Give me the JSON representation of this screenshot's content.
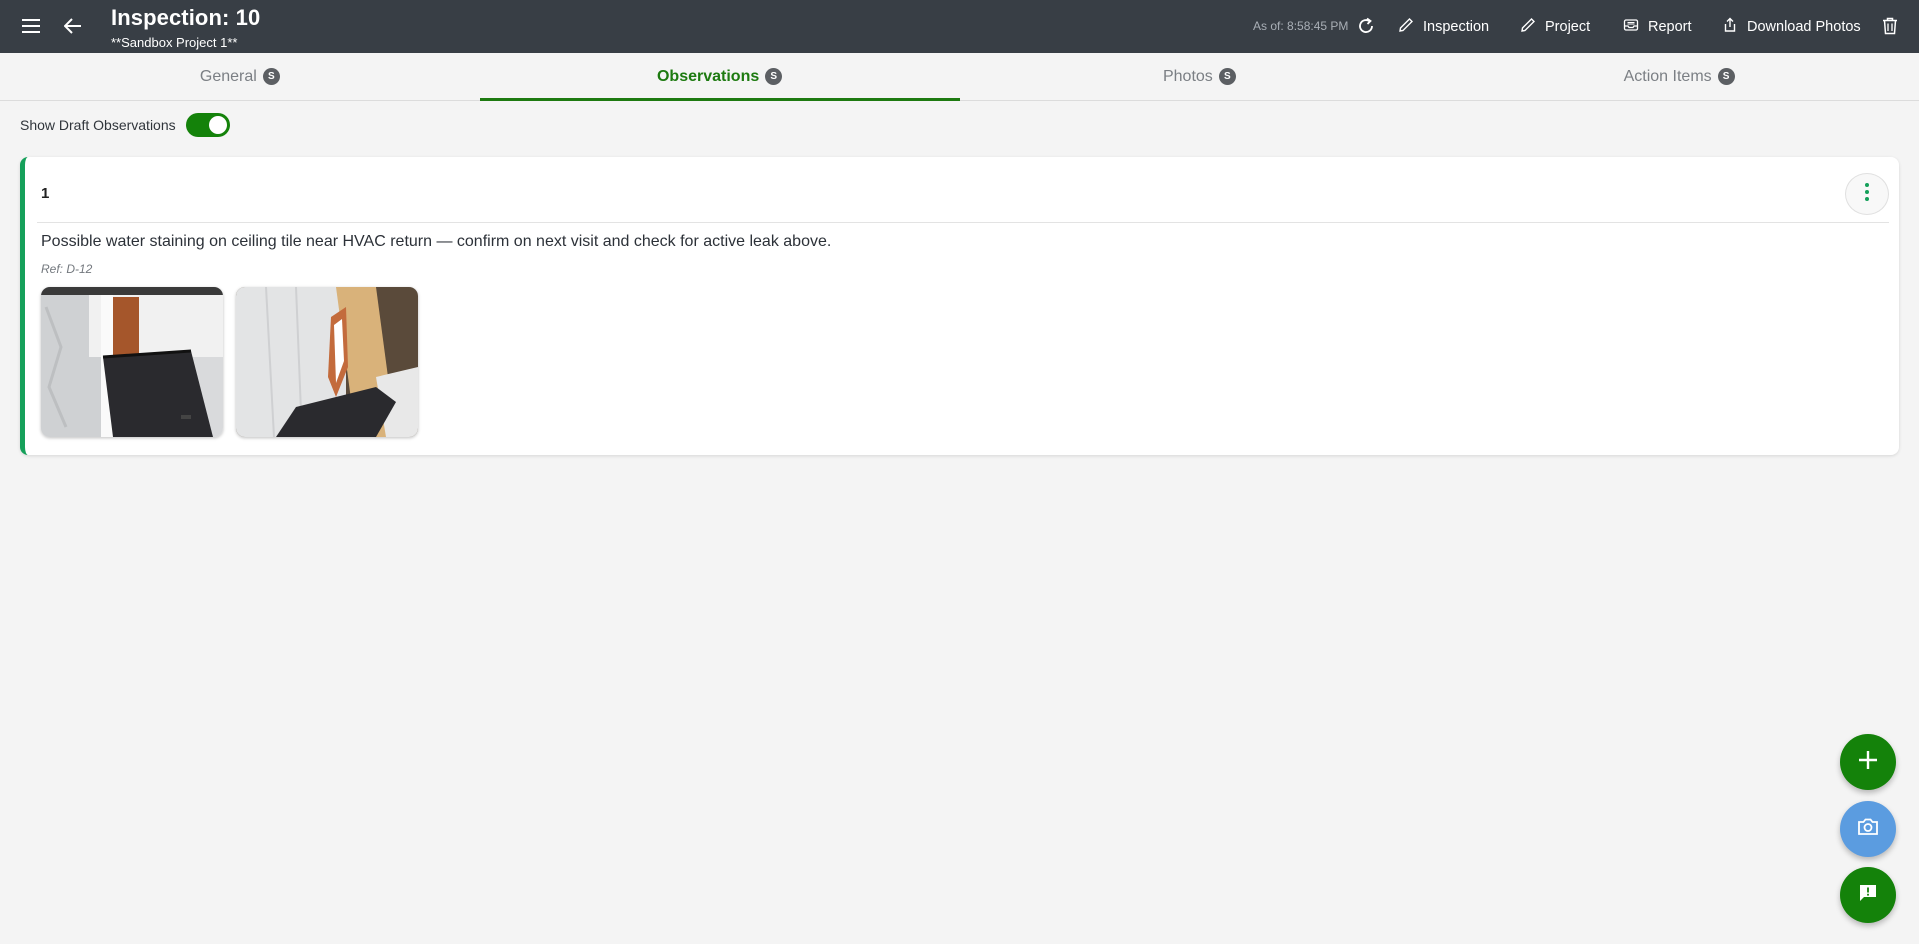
{
  "header": {
    "title": "Inspection: 10",
    "subtitle": "**Sandbox Project 1**",
    "as_of": "As of: 8:58:45 PM",
    "actions": {
      "inspection": "Inspection",
      "project": "Project",
      "report": "Report",
      "download_photos": "Download Photos"
    }
  },
  "tabs": [
    {
      "label": "General",
      "badge": "S"
    },
    {
      "label": "Observations",
      "badge": "S",
      "active": true
    },
    {
      "label": "Photos",
      "badge": "S"
    },
    {
      "label": "Action Items",
      "badge": "S"
    }
  ],
  "toggle": {
    "label": "Show Draft Observations",
    "on": true
  },
  "observation": {
    "number": "1",
    "text": "Possible water staining on ceiling tile near HVAC return — confirm on next visit and check for active leak above.",
    "ref": "Ref: D-12",
    "photos": [
      "photo-of-white-siding-with-black-box",
      "photo-of-white-siding-with-wood-board"
    ]
  },
  "colors": {
    "topbar": "#383e45",
    "accent_green": "#14820a",
    "card_border": "#15a05a",
    "camera_fab": "#5b9ce0"
  },
  "icons": [
    "menu-icon",
    "back-arrow-icon",
    "refresh-icon",
    "pencil-icon",
    "report-icon",
    "share-icon",
    "trash-icon",
    "more-vert-icon",
    "plus-icon",
    "camera-icon",
    "feedback-icon"
  ]
}
